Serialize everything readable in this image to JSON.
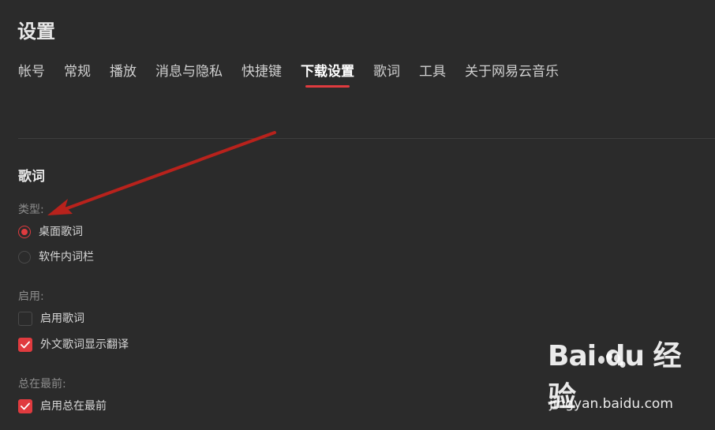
{
  "page": {
    "title": "设置"
  },
  "tabs": [
    {
      "label": "帐号",
      "active": false
    },
    {
      "label": "常规",
      "active": false
    },
    {
      "label": "播放",
      "active": false
    },
    {
      "label": "消息与隐私",
      "active": false
    },
    {
      "label": "快捷键",
      "active": false
    },
    {
      "label": "下载设置",
      "active": true
    },
    {
      "label": "歌词",
      "active": false
    },
    {
      "label": "工具",
      "active": false
    },
    {
      "label": "关于网易云音乐",
      "active": false
    }
  ],
  "lyrics": {
    "section_title": "歌词",
    "type": {
      "label": "类型:",
      "options": [
        {
          "label": "桌面歌词",
          "checked": true
        },
        {
          "label": "软件内词栏",
          "checked": false
        }
      ]
    },
    "enable": {
      "label": "启用:",
      "options": [
        {
          "label": "启用歌词",
          "checked": false
        },
        {
          "label": "外文歌词显示翻译",
          "checked": true
        }
      ]
    },
    "on_top": {
      "label": "总在最前:",
      "options": [
        {
          "label": "启用总在最前",
          "checked": true
        }
      ]
    }
  },
  "watermark": {
    "brand": "Bai du 经验",
    "url": "jingyan.baidu.com"
  },
  "colors": {
    "background": "#2b2b2b",
    "accent": "#e03b3f",
    "annotation_arrow": "#b8221c"
  },
  "icons": {
    "annotation": "red-arrow-icon",
    "check": "checkmark-icon",
    "watermark": "baidu-paw-icon"
  }
}
